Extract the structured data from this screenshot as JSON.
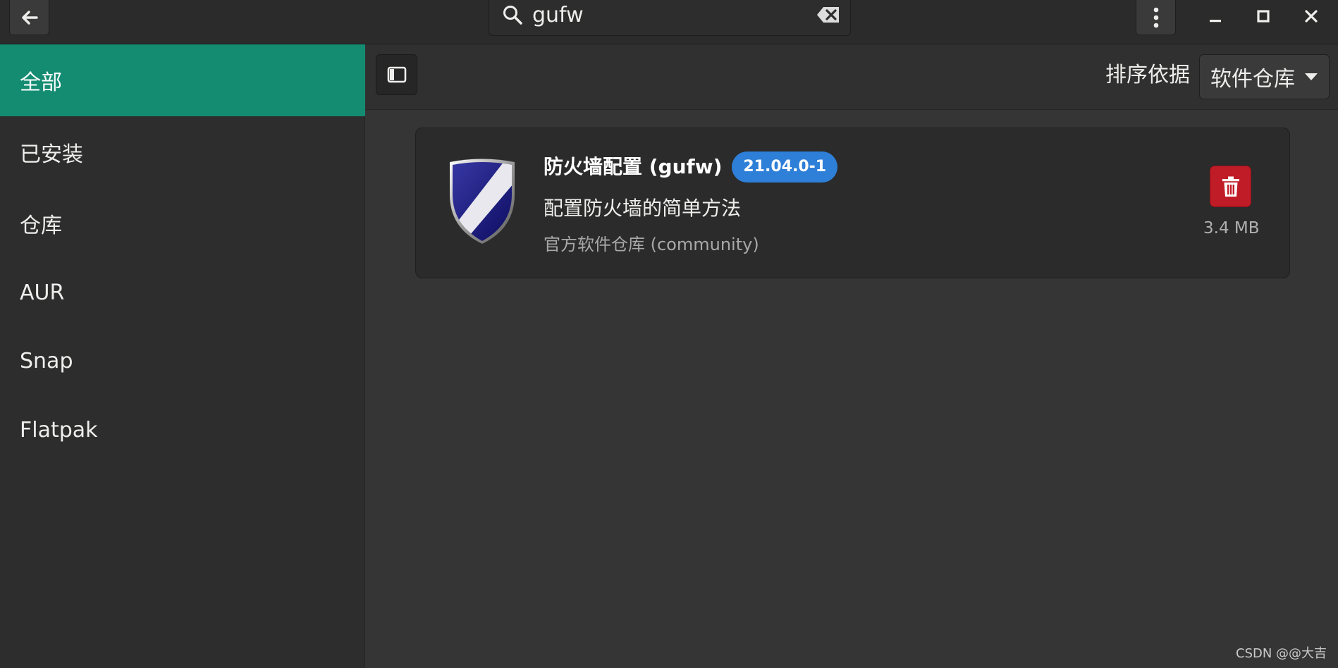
{
  "header": {
    "search_value": "gufw"
  },
  "sidebar": {
    "items": [
      {
        "label": "全部",
        "active": true
      },
      {
        "label": "已安装",
        "active": false
      },
      {
        "label": "仓库",
        "active": false
      },
      {
        "label": "AUR",
        "active": false
      },
      {
        "label": "Snap",
        "active": false
      },
      {
        "label": "Flatpak",
        "active": false
      }
    ]
  },
  "toolbar": {
    "sort_label": "排序依据",
    "sort_value": "软件仓库"
  },
  "results": [
    {
      "name": "防火墙配置 (gufw)",
      "version": "21.04.0-1",
      "description": "配置防火墙的简单方法",
      "repo": "官方软件仓库 (community)",
      "size": "3.4 MB",
      "icon": "shield-icon"
    }
  ],
  "watermark": "CSDN @@大吉",
  "colors": {
    "accent": "#148c72",
    "badge": "#2e7fd8",
    "remove": "#c01c28"
  }
}
